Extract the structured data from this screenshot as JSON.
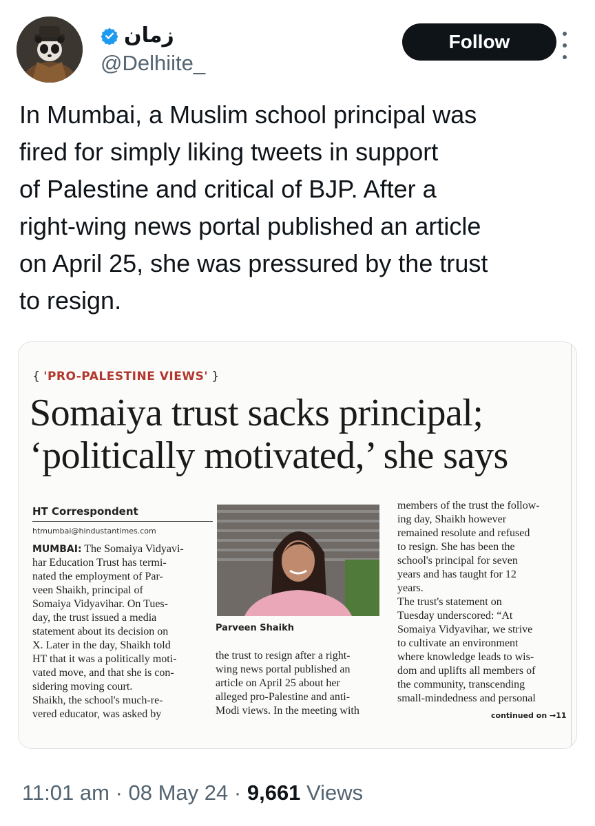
{
  "user": {
    "display_name": "زمان",
    "handle": "@Delhiite_",
    "verified": true,
    "avatar_icon": "avatar-image"
  },
  "actions": {
    "follow_label": "Follow",
    "more_icon": "more-vertical-icon"
  },
  "tweet": {
    "lines": [
      "In Mumbai, a Muslim school principal was",
      "fired for simply liking tweets in support",
      "of Palestine and critical of BJP. After a",
      "right-wing news portal published an article",
      "on April 25, she was pressured by the trust",
      "to resign."
    ]
  },
  "clipping": {
    "kicker_open": "{ ",
    "kicker": "'PRO-PALESTINE VIEWS'",
    "kicker_close": " }",
    "headline": [
      "Somaiya trust sacks principal;",
      "‘politically motivated,’ she says"
    ],
    "byline": "HT Correspondent",
    "email": "htmumbai@hindustantimes.com",
    "dateline": "MUMBAI:",
    "col1": [
      " The Somaiya Vidyavi-",
      "har Education Trust has termi-",
      "nated the employment of Par-",
      "veen Shaikh, principal of",
      "Somaiya Vidyavihar. On Tues-",
      "day, the trust issued a media",
      "statement about its decision on",
      "X. Later in the day, Shaikh told",
      "HT that it was a politically moti-",
      "vated move, and that she is con-",
      "sidering moving court.",
      "    Shaikh, the school's much-re-",
      "vered educator, was asked by"
    ],
    "photo_caption": "Parveen Shaikh",
    "col2": [
      "the trust to resign after a right-",
      "wing news portal published an",
      "article on April 25 about her",
      "alleged pro-Palestine and anti-",
      "Modi views. In the meeting with"
    ],
    "col3": [
      "members of the trust the follow-",
      "ing day, Shaikh however",
      "remained resolute and refused",
      "to resign. She has been the",
      "school's principal for seven",
      "years and has taught for 12",
      "years.",
      "    The trust's statement on",
      "Tuesday underscored: “At",
      "Somaiya Vidyavihar, we strive",
      "to cultivate an environment",
      "where knowledge leads to wis-",
      "dom and uplifts all members of",
      "the community, transcending",
      "small-mindedness and personal"
    ],
    "continued": "continued on →11"
  },
  "meta": {
    "time": "11:01 am",
    "separator": " · ",
    "date": "08 May 24",
    "views_count": "9,661",
    "views_label": " Views"
  }
}
